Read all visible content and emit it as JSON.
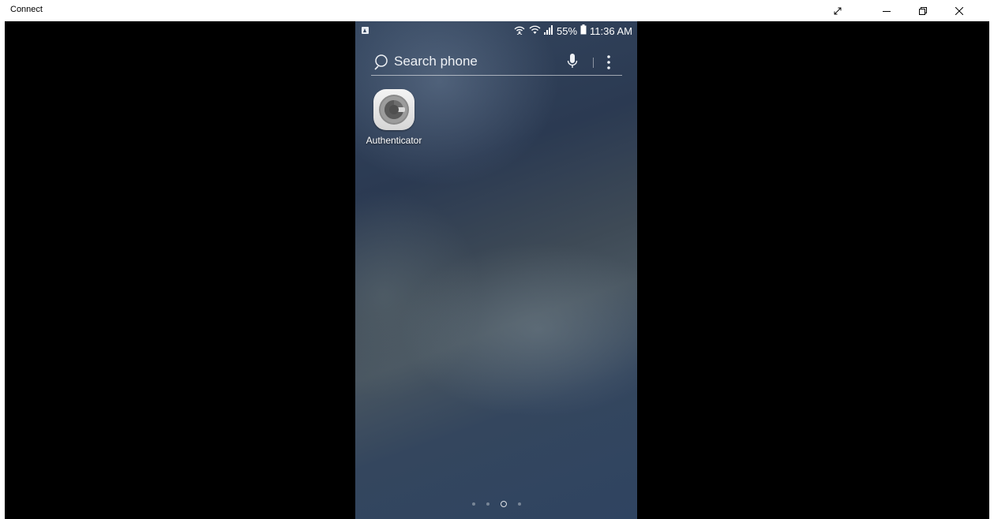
{
  "window": {
    "title": "Connect",
    "controls": [
      "expand-icon",
      "minimize-icon",
      "restore-icon",
      "close-icon"
    ]
  },
  "phone": {
    "statusbar": {
      "notification_icon": "picture-notification-icon",
      "signal_icons": [
        "hotspot-icon",
        "wifi-icon",
        "cell-signal-icon"
      ],
      "battery_percent": "55%",
      "battery_icon": "battery-icon",
      "time": "11:36 AM"
    },
    "search": {
      "placeholder": "Search phone",
      "icons": [
        "search-icon",
        "microphone-icon",
        "more-vertical-icon"
      ]
    },
    "apps": [
      {
        "label": "Authenticator",
        "icon": "google-authenticator-icon"
      }
    ],
    "page_indicator": {
      "count": 4,
      "active_index": 2
    }
  },
  "colors": {
    "titlebar_bg": "#ffffff",
    "viewport_bg": "#000000",
    "wallpaper_base": "#34465f",
    "text_light": "#ffffff"
  }
}
